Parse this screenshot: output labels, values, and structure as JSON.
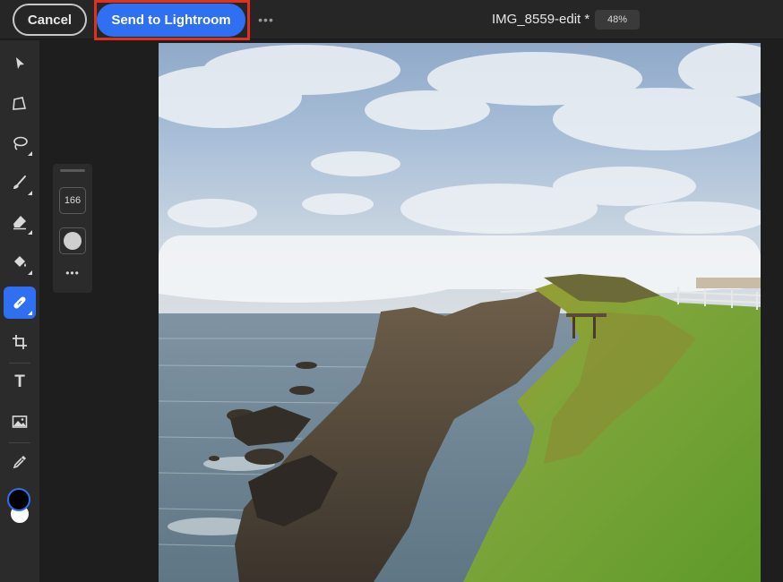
{
  "header": {
    "cancel_label": "Cancel",
    "send_label": "Send to Lightroom",
    "more_label": "•••",
    "document_title": "IMG_8559-edit *",
    "zoom_level": "48%"
  },
  "toolbar": {
    "tools": [
      {
        "name": "select",
        "icon": "arrow-cursor-icon"
      },
      {
        "name": "transform",
        "icon": "transform-icon"
      },
      {
        "name": "lasso",
        "icon": "lasso-icon"
      },
      {
        "name": "brush",
        "icon": "brush-icon"
      },
      {
        "name": "eraser",
        "icon": "eraser-icon"
      },
      {
        "name": "fill",
        "icon": "paint-bucket-icon"
      },
      {
        "name": "healing",
        "icon": "healing-bandage-icon",
        "active": true
      },
      {
        "name": "crop",
        "icon": "crop-icon"
      },
      {
        "name": "type",
        "icon": "type-icon",
        "label": "T"
      },
      {
        "name": "image",
        "icon": "image-icon"
      },
      {
        "name": "eyedropper",
        "icon": "eyedropper-icon"
      }
    ],
    "foreground_color": "#000000",
    "background_color": "#ffffff"
  },
  "brush_options": {
    "size": "166",
    "more_label": "•••"
  },
  "colors": {
    "accent": "#2f6ff2",
    "highlight_box": "#e0311f"
  }
}
